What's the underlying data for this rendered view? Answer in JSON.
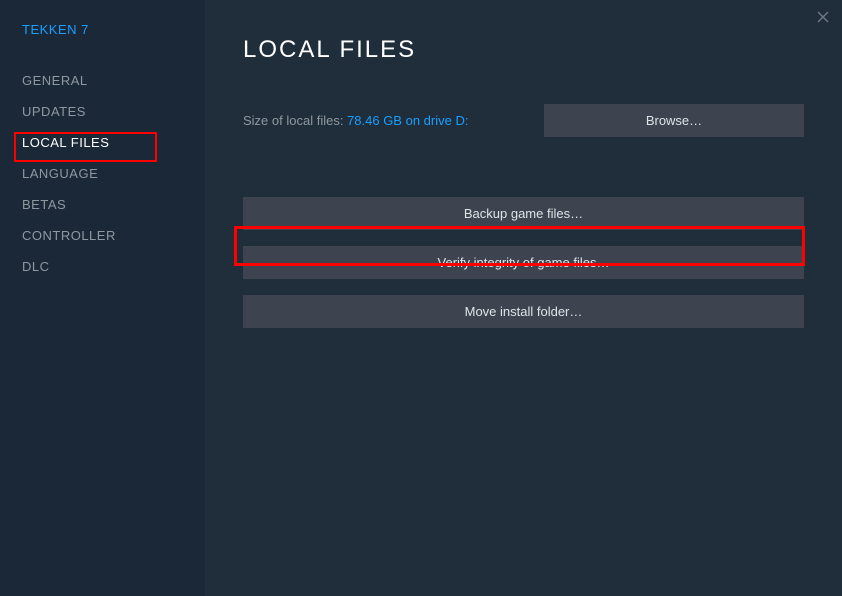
{
  "gameTitle": "TEKKEN 7",
  "sidebar": {
    "items": [
      {
        "label": "GENERAL",
        "id": "general"
      },
      {
        "label": "UPDATES",
        "id": "updates"
      },
      {
        "label": "LOCAL FILES",
        "id": "local-files"
      },
      {
        "label": "LANGUAGE",
        "id": "language"
      },
      {
        "label": "BETAS",
        "id": "betas"
      },
      {
        "label": "CONTROLLER",
        "id": "controller"
      },
      {
        "label": "DLC",
        "id": "dlc"
      }
    ],
    "activeIndex": 2
  },
  "content": {
    "title": "LOCAL FILES",
    "sizeLabel": "Size of local files: ",
    "sizeValue": "78.46 GB on drive D:",
    "browseLabel": "Browse…",
    "backupLabel": "Backup game files…",
    "verifyLabel": "Verify integrity of game files…",
    "moveLabel": "Move install folder…"
  },
  "annotations": {
    "highlightSidebar": "local-files",
    "highlightButton": "verify-integrity"
  }
}
